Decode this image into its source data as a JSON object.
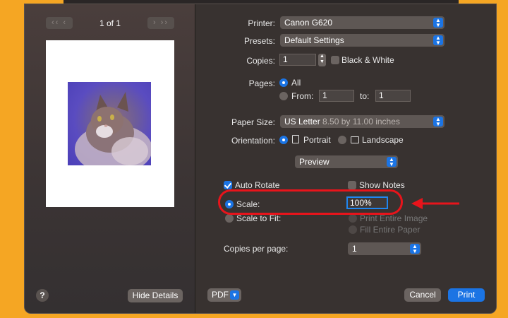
{
  "dialog": {
    "page_count": "1 of 1",
    "nav_prev": "‹‹ ‹",
    "nav_next": "› ››"
  },
  "labels": {
    "printer": "Printer:",
    "presets": "Presets:",
    "copies": "Copies:",
    "pages": "Pages:",
    "paper_size": "Paper Size:",
    "orientation": "Orientation:",
    "copies_per_page": "Copies per page:"
  },
  "printer": {
    "value": "Canon G620"
  },
  "presets": {
    "value": "Default Settings"
  },
  "copies": {
    "value": "1"
  },
  "black_white": {
    "label": "Black & White",
    "checked": false
  },
  "pages": {
    "all_label": "All",
    "from_label": "From:",
    "to_label": "to:",
    "from_value": "1",
    "to_value": "1",
    "selected": "All"
  },
  "paper_size": {
    "value": "US Letter",
    "detail": "8.50 by 11.00 inches"
  },
  "orientation": {
    "portrait_label": "Portrait",
    "landscape_label": "Landscape",
    "selected": "Portrait"
  },
  "section_popup": {
    "value": "Preview"
  },
  "preview_options": {
    "auto_rotate": "Auto Rotate",
    "show_notes": "Show Notes",
    "scale": "Scale:",
    "scale_value": "100%",
    "scale_to_fit": "Scale to Fit:",
    "print_entire_image": "Print Entire Image",
    "fill_entire_paper": "Fill Entire Paper"
  },
  "copies_per_page": {
    "value": "1"
  },
  "buttons": {
    "help": "?",
    "hide_details": "Hide Details",
    "pdf": "PDF",
    "cancel": "Cancel",
    "print": "Print"
  },
  "colors": {
    "background": "#f5a623",
    "accent": "#1b74e4",
    "annotation": "#e8141b"
  }
}
